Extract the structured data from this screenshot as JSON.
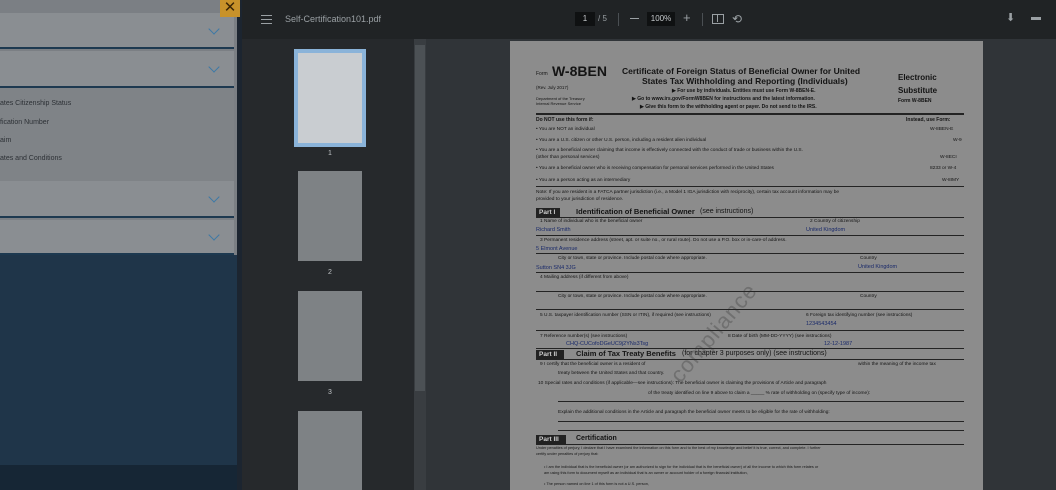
{
  "left_panel": {
    "close_glyph": "✕",
    "items": [
      "ates Citizenship Status",
      "fication Number",
      "aim",
      "ates and Conditions"
    ]
  },
  "toolbar": {
    "menu_icon": "hamburger-icon",
    "filename": "Self-Certification101.pdf",
    "page_current": "1",
    "page_total": "/ 5",
    "zoom_minus": "—",
    "zoom": "100%",
    "zoom_plus": "+",
    "download_glyph": "⬇",
    "print_glyph": "🖶"
  },
  "thumbnails": [
    {
      "num": "1"
    },
    {
      "num": "2"
    },
    {
      "num": "3"
    }
  ],
  "page": {
    "form_small": "Form",
    "form_name": "W-8BEN",
    "rev": "(Rev. July 2017)",
    "dept": "Department of the Treasury",
    "irs": "Internal Revenue Service",
    "title1": "Certificate of Foreign Status of Beneficial Owner for United",
    "title2": "States Tax Withholding and Reporting (Individuals)",
    "sub1": "▶ For use by individuals. Entities must use Form W-8BEN-E.",
    "sub2": "▶ Go to www.irs.gov/FormW8BEN for instructions and the latest information.",
    "sub3": "▶ Give this form to the withholding agent or payer. Do not send to the IRS.",
    "right1": "Electronic",
    "right2": "Substitute",
    "right3": "Form W-8BEN",
    "donot": "Do NOT use this form if:",
    "instead": "Instead, use Form:",
    "uses": [
      {
        "t": "• You are NOT an individual",
        "f": "W-8BEN-E"
      },
      {
        "t": "• You are a U.S. citizen or other U.S. person, including a resident alien individual",
        "f": "W-9"
      },
      {
        "t": "• You are a beneficial owner claiming that income is effectively connected with the conduct of trade or business within the U.S.",
        "f": ""
      },
      {
        "t": "  (other than personal services)",
        "f": "W-8ECI"
      },
      {
        "t": "• You are a beneficial owner who is receiving compensation for personal services performed in the United States",
        "f": "8233 or W-4"
      },
      {
        "t": "• You are a person acting as an intermediary",
        "f": "W-8IMY"
      }
    ],
    "note1": "Note: If you are resident in a FATCA partner jurisdiction (i.e., a Model 1 IGA jurisdiction with reciprocity), certain tax account information may be",
    "note2": "provided to your jurisdiction of residence.",
    "part1_tag": "Part I",
    "part1_title": "Identification of Beneficial Owner",
    "part1_see": "(see instructions)",
    "l1": "1    Name of individual who is the beneficial owner",
    "l1v": "Richard Smith",
    "l2": "2    Country of citizenship",
    "l2v": "United Kingdom",
    "l3": "3    Permanent residence address (street, apt. or suite no., or rural route). Do not use a P.O. box or in-care-of address.",
    "l3v": "5 Elmont Avenue",
    "city": "City or town, state or province. Include postal code where appropriate.",
    "country": "Country",
    "cityv": "Sutton SN4 3JG",
    "countryv": "United Kingdom",
    "l4": "4    Mailing address (if different from above)",
    "city2": "City or town, state or province. Include postal code where appropriate.",
    "country2": "Country",
    "l5": "5    U.S. taxpayer identification number (SSN or ITIN), if required (see instructions)",
    "l6": "6    Foreign tax identifying number (see instructions)",
    "l6v": "1234543454",
    "l7": "7    Reference number(s) (see instructions)",
    "l7v": "CHQ-CUCofoDGeUC9j2YNs3Tsg",
    "l8": "8    Date of birth (MM-DD-YYYY) (see instructions)",
    "l8v": "12-12-1987",
    "part2_tag": "Part II",
    "part2_title": "Claim of Tax Treaty Benefits",
    "part2_see": "(for chapter 3 purposes only) (see instructions)",
    "l9": "9    I certify that the beneficial owner is a resident of",
    "l9b": "within the meaning of the income tax",
    "l9c": "treaty between the United States and that country.",
    "l10": "10   Special rates and conditions (if applicable—see instructions): The beneficial owner is claiming the provisions of Article and paragraph",
    "l10b": "of the treaty identified on line 9 above to claim a _____ % rate of withholding on (specify type of income):",
    "l10c": "Explain the additional conditions in the Article and paragraph the beneficial owner meets to be eligible for the rate of withholding:",
    "part3_tag": "Part III",
    "part3_title": "Certification",
    "cert1": "Under penalties of perjury, I declare that I have examined the information on this form and to the best of my knowledge and belief it is true, correct, and complete. I further",
    "cert2": "certify under penalties of perjury that:",
    "cert3": "•    I am the individual that is the beneficial owner (or am authorized to sign for the individual that is the beneficial owner) of all the income to which this form relates or",
    "cert4": "     am using this form to document myself as an individual that is an owner or account holder of a foreign financial institution,",
    "cert5": "•    The person named on line 1 of this form is not a U.S. person,",
    "watermark": "compliance"
  }
}
